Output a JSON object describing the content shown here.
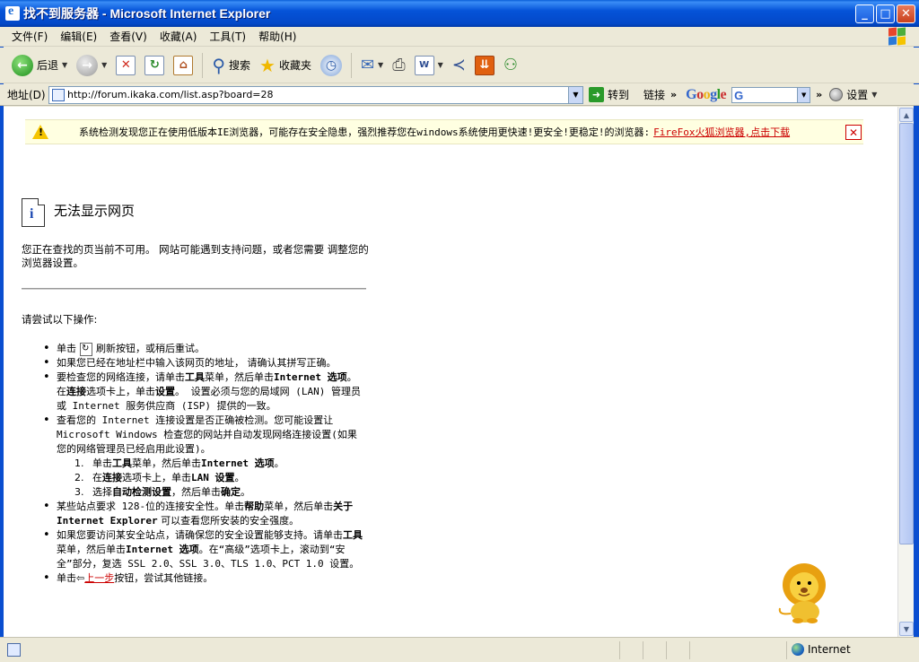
{
  "window": {
    "title": "找不到服务器 - Microsoft Internet Explorer",
    "minimize": "_",
    "maximize": "□",
    "close": "✕"
  },
  "menu": [
    "文件(F)",
    "编辑(E)",
    "查看(V)",
    "收藏(A)",
    "工具(T)",
    "帮助(H)"
  ],
  "toolbar": {
    "back_label": "后退",
    "search_label": "搜索",
    "favorites_label": "收藏夹"
  },
  "address": {
    "label": "地址(D)",
    "url": "http://forum.ikaka.com/list.asp?board=28",
    "go_label": "转到",
    "links_label": "链接",
    "google_label": "Google",
    "google_g": "G",
    "settings_label": "设置"
  },
  "warning": {
    "text": "系统检测发现您正在使用低版本IE浏览器，可能存在安全隐患，强烈推荐您在windows系统使用更快速!更安全!更稳定!的浏览器:",
    "link": "FireFox火狐浏览器,点击下载",
    "close": "✕"
  },
  "error": {
    "title": "无法显示网页",
    "description": "您正在查找的页当前不可用。 网站可能遇到支持问题，或者您需要 调整您的浏览器设置。",
    "try_heading": "请尝试以下操作:",
    "tip1_a": "单击",
    "tip1_b": "刷新按钮，或稍后重试。",
    "tip2": "如果您已经在地址栏中输入该网页的地址， 请确认其拼写正确。",
    "tip3_a": "要检查您的网络连接，请单击",
    "tip3_b": "工具",
    "tip3_c": "菜单，然后单击",
    "tip3_d": "Internet 选项",
    "tip3_e": "。在",
    "tip3_f": "连接",
    "tip3_g": "选项卡上，单击",
    "tip3_h": "设置",
    "tip3_i": "。 设置必须与您的局域网 (LAN) 管理员或 Internet 服务供应商 (ISP) 提供的一致。",
    "tip4": "查看您的 Internet 连接设置是否正确被检测。您可能设置让 Microsoft Windows 检查您的网站并自动发现网络连接设置(如果您的网络管理员已经启用此设置)。",
    "sub1_num": "1.",
    "sub1_a": "单击",
    "sub1_b": "工具",
    "sub1_c": "菜单，然后单击",
    "sub1_d": "Internet 选项",
    "sub1_e": "。",
    "sub2_num": "2.",
    "sub2_a": "在",
    "sub2_b": "连接",
    "sub2_c": "选项卡上，单击",
    "sub2_d": "LAN 设置",
    "sub2_e": "。",
    "sub3_num": "3.",
    "sub3_a": "选择",
    "sub3_b": "自动检测设置",
    "sub3_c": "，然后单击",
    "sub3_d": "确定",
    "sub3_e": "。",
    "tip5_a": "某些站点要求 128-位的连接安全性。单击",
    "tip5_b": "帮助",
    "tip5_c": "菜单，然后单击",
    "tip5_d": "关于 Internet Explorer",
    "tip5_e": " 可以查看您所安装的安全强度。",
    "tip6_a": "如果您要访问某安全站点，请确保您的安全设置能够支持。请单击",
    "tip6_b": "工具",
    "tip6_c": "菜单，然后单击",
    "tip6_d": "Internet 选项",
    "tip6_e": "。在“高级”选项卡上，滚动到“安全”部分，复选 SSL 2.0、SSL 3.0、TLS 1.0、PCT 1.0 设置。",
    "tip7_a": "单击",
    "tip7_link": "上一步",
    "tip7_b": "按钮，尝试其他链接。"
  },
  "status": {
    "zone": "Internet"
  }
}
